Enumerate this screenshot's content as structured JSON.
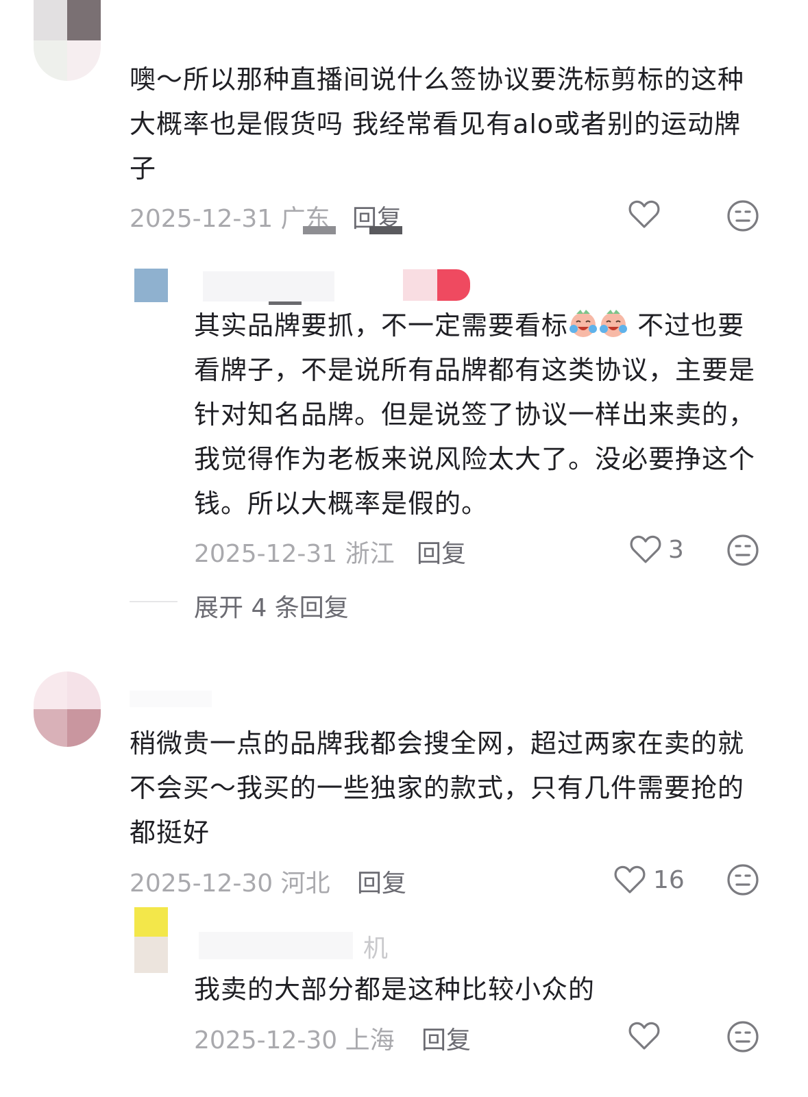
{
  "comments": [
    {
      "text": "噢～所以那种直播间说什么签协议要洗标剪标的这种 大概率也是假货吗 我经常看见有alo或者别的运动牌子",
      "date": "2025-12-31",
      "location": "广东",
      "reply_label": "回复",
      "likes": ""
    },
    {
      "text_before": "其实品牌要抓，不一定需要看标",
      "text_after": " 不过也要看牌子，不是说所有品牌都有这类协议，主要是针对知名品牌。但是说签了协议一样出来卖的，我觉得作为老板来说风险太大了。没必要挣这个钱。所以大概率是假的。",
      "date": "2025-12-31",
      "location": "浙江",
      "reply_label": "回复",
      "likes": "3"
    },
    {
      "text": "稍微贵一点的品牌我都会搜全网，超过两家在卖的就不会买～我买的一些独家的款式，只有几件需要抢的都挺好",
      "date": "2025-12-30",
      "location": "河北",
      "reply_label": "回复",
      "likes": "16"
    },
    {
      "username_partial": "机",
      "text": "我卖的大部分都是这种比较小众的",
      "date": "2025-12-30",
      "location": "上海",
      "reply_label": "回复",
      "likes": ""
    }
  ],
  "expand_replies": "展开 4 条回复",
  "icons": {
    "like": "heart-outline-icon",
    "dislike": "neutral-face-icon",
    "emoji": "crying-laughing-emoji"
  },
  "colors": {
    "text": "#1f1f24",
    "meta": "#a9a9ad",
    "reply": "#6b6b72"
  }
}
